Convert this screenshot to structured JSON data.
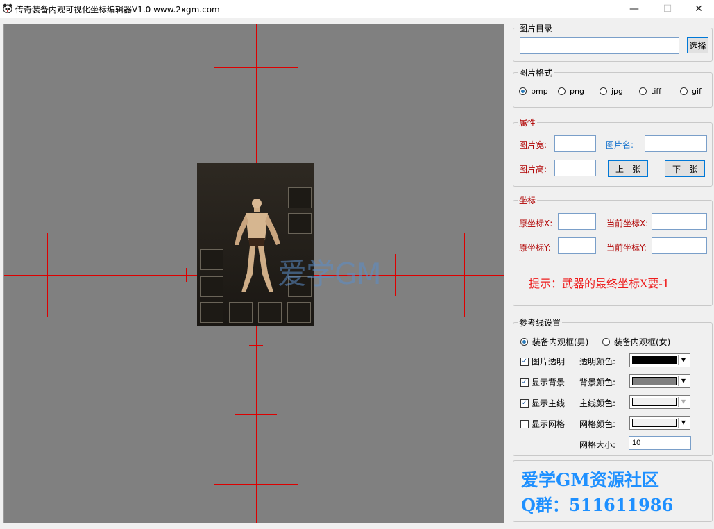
{
  "window": {
    "title": "传奇装备内观可视化坐标编辑器V1.0  www.2xgm.com",
    "minimize": "—",
    "maximize": "☐",
    "close": "✕"
  },
  "canvas": {
    "background": "#808080",
    "line_color": "#dd0000",
    "watermark": "爱学GM"
  },
  "image_dir": {
    "title": "图片目录",
    "value": "",
    "choose_button": "选择"
  },
  "image_format": {
    "title": "图片格式",
    "options": [
      "bmp",
      "png",
      "jpg",
      "tiff",
      "gif"
    ],
    "selected": "bmp"
  },
  "properties": {
    "title": "属性",
    "width_label": "图片宽:",
    "name_label": "图片名:",
    "height_label": "图片高:",
    "prev_button": "上一张",
    "next_button": "下一张",
    "width_value": "",
    "name_value": "",
    "height_value": ""
  },
  "coords": {
    "title": "坐标",
    "orig_x_label": "原坐标X:",
    "cur_x_label": "当前坐标X:",
    "orig_y_label": "原坐标Y:",
    "cur_y_label": "当前坐标Y:",
    "hint": "提示：武器的最终坐标X要-1"
  },
  "refline": {
    "title": "参考线设置",
    "radio_male": "装备内观框(男)",
    "radio_female": "装备内观框(女)",
    "selected": "male",
    "chk_transparent": "图片透明",
    "chk_background": "显示背景",
    "chk_mainline": "显示主线",
    "chk_grid": "显示网格",
    "transparent_color_label": "透明颜色:",
    "background_color_label": "背景颜色:",
    "mainline_color_label": "主线颜色:",
    "grid_color_label": "网格颜色:",
    "grid_size_label": "网格大小:",
    "grid_size_value": "10",
    "transparent_color": "#000000",
    "background_color": "#808080",
    "mainline_color": "#f0f0f0",
    "grid_color": "#f0f0f0"
  },
  "ad": {
    "line1": "爱学GM资源社区",
    "line2": "Q群：511611986"
  }
}
